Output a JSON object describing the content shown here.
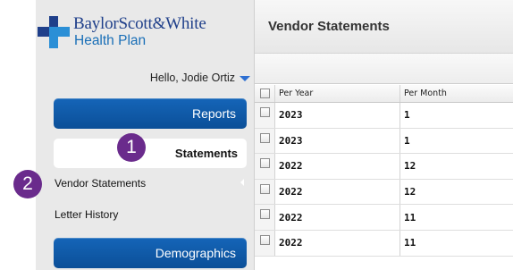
{
  "brand": {
    "line1": "BaylorScott&White",
    "line2": "Health Plan"
  },
  "sidebar": {
    "greeting": "Hello, Jodie Ortiz",
    "reports_label": "Reports",
    "statements_label": "Statements",
    "sub_items": [
      "Vendor Statements",
      "Letter History"
    ],
    "demographics_label": "Demographics"
  },
  "callouts": [
    "1",
    "2"
  ],
  "main": {
    "title": "Vendor Statements",
    "columns": [
      "Per Year",
      "Per Month"
    ],
    "rows": [
      {
        "year": "2023",
        "month": "1"
      },
      {
        "year": "2023",
        "month": "1"
      },
      {
        "year": "2022",
        "month": "12"
      },
      {
        "year": "2022",
        "month": "12"
      },
      {
        "year": "2022",
        "month": "11"
      },
      {
        "year": "2022",
        "month": "11"
      }
    ]
  },
  "colors": {
    "sidebar_bg": "#e9e9e9",
    "button_blue": "#0b4f98",
    "callout_purple": "#6a2b8c",
    "brand_navy": "#1f3f8a",
    "brand_blue": "#1a6fb7"
  }
}
